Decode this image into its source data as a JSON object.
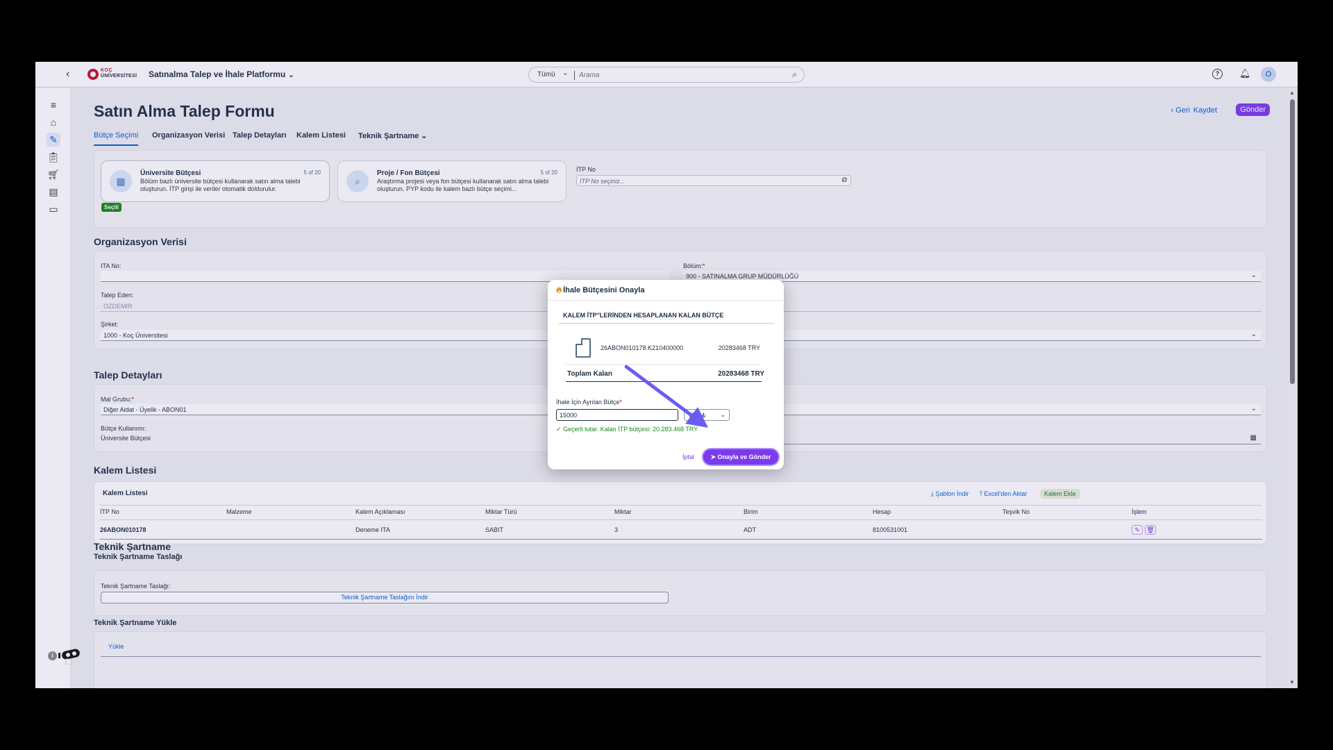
{
  "shell": {
    "logo_line1": "KOÇ",
    "logo_line2": "ÜNİVERSİTESİ",
    "app_title": "Satınalma Talep ve İhale Platformu",
    "search_scope": "Tümü",
    "search_placeholder": "Arama",
    "avatar_initial": "O"
  },
  "page": {
    "title": "Satın Alma Talep Formu",
    "actions": {
      "back": "Geri",
      "save": "Kaydet",
      "send": "Gönder"
    },
    "tabs": [
      "Bütçe Seçimi",
      "Organizasyon Verisi",
      "Talep Detayları",
      "Kalem Listesi",
      "Teknik Şartname"
    ]
  },
  "budget": {
    "cards": [
      {
        "title": "Üniversite Bütçesi",
        "count": "5 of 20",
        "desc": "Bölüm bazlı üniversite bütçesi kullanarak satın alma talebi oluşturun. İTP girişi ile veriler otomatik doldurulur."
      },
      {
        "title": "Proje / Fon Bütçesi",
        "count": "5 of 20",
        "desc": "Araştırma projesi veya fon bütçesi kullanarak satın alma talebi oluşturun. PYP kodu ile kalem bazlı bütçe seçimi..."
      }
    ],
    "selected_badge": "Seçili",
    "itp_label": "İTP No",
    "itp_placeholder": "İTP No seçiniz..."
  },
  "org": {
    "title": "Organizasyon Verisi",
    "ita_label": "ITA No:",
    "ita_value": "",
    "bolum_label": "Bölüm:",
    "bolum_value": "900 - SATINALMA GRUP MÜDÜRLÜĞÜ",
    "talep_eden_label": "Talep Eden:",
    "talep_eden_value": "OZDEMIR",
    "sirket_label": "Şirket:",
    "sirket_value": "1000 - Koç Üniversitesi"
  },
  "details": {
    "title": "Talep Detayları",
    "mal_grubu_label": "Mal Grubu:",
    "mal_grubu_value": "Diğer Aidat - Üyelik - ABON01",
    "butce_kullanimi_label": "Bütçe Kullanımı:",
    "butce_kullanimi_value": "Üniversite Bütçesi"
  },
  "items": {
    "title": "Kalem Listesi",
    "sub_title": "Kalem Listesi",
    "btn_template": "Şablon İndir",
    "btn_excel": "Excel'den Aktar",
    "btn_add": "Kalem Ekle",
    "columns": [
      "İTP No",
      "Malzeme",
      "Kalem Açıklaması",
      "Miktar Türü",
      "Miktar",
      "Birim",
      "Hesap",
      "Teşvik No",
      "İşlem"
    ],
    "rows": [
      [
        "26ABON010178",
        "",
        "Deneme ITA",
        "SABIT",
        "3",
        "ADT",
        "8100531001",
        "",
        ""
      ]
    ]
  },
  "spec": {
    "title": "Teknik Şartname",
    "draft_title": "Teknik Şartname Taslağı",
    "draft_label": "Teknik Şartname Taslağı:",
    "draft_btn": "Teknik Şartname Taslağını İndir",
    "upload_title": "Teknik Şartname Yükle",
    "upload_btn": "Yükle"
  },
  "dialog": {
    "title": "İhale Bütçesini Onayla",
    "subtitle": "KALEM İTP\"LERİNDEN HESAPLANAN KALAN BÜTÇE",
    "line_code": "26ABON010178 K210400000",
    "line_amount": "20283468 TRY",
    "total_label": "Toplam Kalan",
    "total_value": "20283468 TRY",
    "budget_label": "İhale İçin Ayrılan Bütçe",
    "budget_value": "15000",
    "currency": "TRY ₺",
    "valid_msg": "Geçerli tutar. Kalan İTP bütçesi: 20.283.468 TRY",
    "cancel": "İptal",
    "confirm": "Onayla ve Gönder"
  },
  "colors": {
    "accent": "#7c3aed",
    "link": "#0064d9",
    "success": "#188918",
    "brand": "#c8102e"
  }
}
